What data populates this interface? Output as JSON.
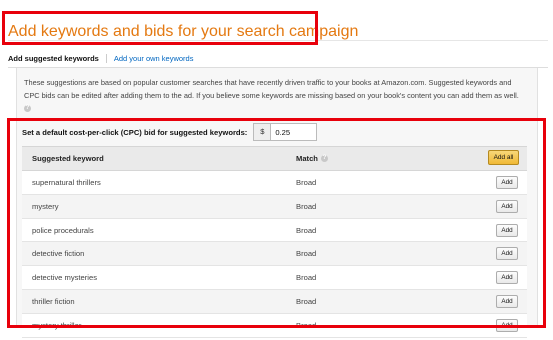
{
  "page": {
    "title": "Add keywords and bids for your search campaign"
  },
  "tabs": [
    {
      "label": "Add suggested keywords",
      "active": true
    },
    {
      "label": "Add your own keywords",
      "active": false
    }
  ],
  "description": "These suggestions are based on popular customer searches that have recently driven traffic to your books at Amazon.com. Suggested keywords and CPC bids can be edited after adding them to the ad. If you believe some keywords are missing based on your book's content you can add them as well.",
  "cpc": {
    "label": "Set a default cost-per-click (CPC) bid for suggested keywords:",
    "currency": "$",
    "value": "0.25"
  },
  "table": {
    "headers": {
      "keyword": "Suggested keyword",
      "match": "Match",
      "add_all": "Add all"
    },
    "add_label": "Add",
    "rows": [
      {
        "keyword": "supernatural thrillers",
        "match": "Broad"
      },
      {
        "keyword": "mystery",
        "match": "Broad"
      },
      {
        "keyword": "police procedurals",
        "match": "Broad"
      },
      {
        "keyword": "detective fiction",
        "match": "Broad"
      },
      {
        "keyword": "detective mysteries",
        "match": "Broad"
      },
      {
        "keyword": "thriller fiction",
        "match": "Broad"
      },
      {
        "keyword": "mystery thriller",
        "match": "Broad"
      }
    ]
  },
  "colors": {
    "title": "#e47911",
    "link": "#0066c0",
    "annotation_box": "#e8000b",
    "add_all_button": "#f0c14b"
  },
  "icons": {
    "help": "question-circle-icon"
  }
}
